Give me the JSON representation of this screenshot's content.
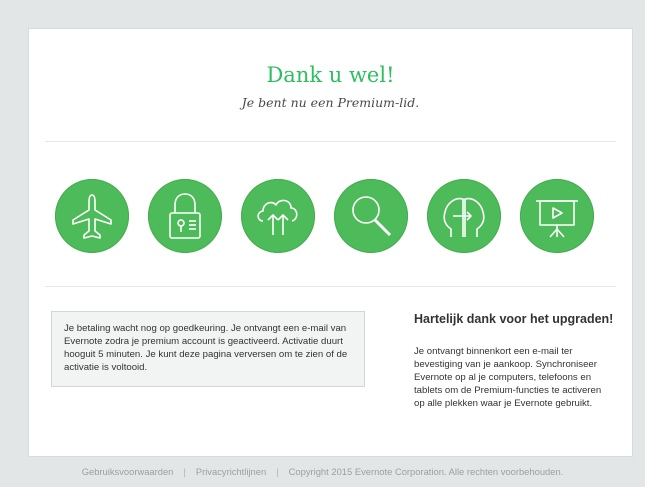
{
  "header": {
    "title": "Dank u wel!",
    "subtitle": "Je bent nu een Premium-lid."
  },
  "features": {
    "icons": [
      "airplane-icon",
      "padlock-icon",
      "cloud-sync-icon",
      "magnifier-icon",
      "presentation-heads-icon",
      "presentation-screen-icon"
    ],
    "accent_color": "#4dbb5a"
  },
  "status": {
    "message": "Je betaling wacht nog op goedkeuring. Je ontvangt een e-mail van Evernote zodra je premium account is geactiveerd. Activatie duurt hooguit 5 minuten. Je kunt deze pagina verversen om te zien of de activatie is voltooid."
  },
  "thanks": {
    "heading": "Hartelijk dank voor het upgraden!",
    "body": "Je ontvangt binnenkort een e-mail ter bevestiging van je aankoop. Synchroniseer Evernote op al je computers, telefoons en tablets om de Premium-functies te activeren op alle plekken waar je Evernote gebruikt."
  },
  "footer": {
    "terms": "Gebruiksvoorwaarden",
    "privacy": "Privacyrichtlijnen",
    "copyright": "Copyright 2015 Evernote Corporation. Alle rechten voorbehouden."
  }
}
